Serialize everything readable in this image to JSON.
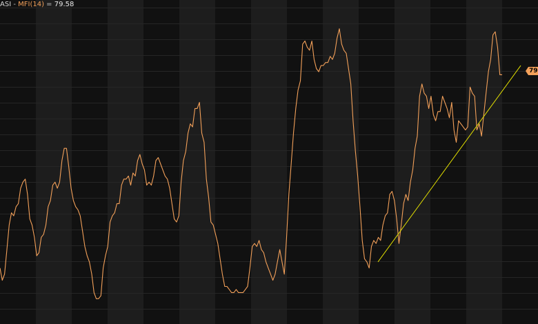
{
  "legend": {
    "ticker": "ASI",
    "separator": " - ",
    "indicator_name": "MFI(14)",
    "equals": " = ",
    "indicator_value": "79.58"
  },
  "value_tag": "79",
  "colors": {
    "background": "#000000",
    "band_dark": "#111111",
    "band_light": "#1d1d1d",
    "gridline": "#262626",
    "mfi_line": "#f4a15a",
    "trendline": "#e3e000",
    "tag": "#f4a15a"
  },
  "chart_data": {
    "type": "line",
    "title": "",
    "xlabel": "",
    "ylabel": "",
    "ylim": [
      0,
      100
    ],
    "grid": true,
    "series": [
      {
        "name": "MFI(14)",
        "values": [
          16,
          12,
          14,
          22,
          30,
          34,
          33,
          36,
          37,
          42,
          44,
          45,
          40,
          32,
          30,
          26,
          20,
          21,
          26,
          27,
          30,
          36,
          38,
          43,
          44,
          42,
          44,
          51,
          55,
          55,
          49,
          42,
          38,
          36,
          35,
          33,
          28,
          23,
          20,
          18,
          14,
          8,
          6,
          6,
          7,
          16,
          20,
          23,
          31,
          33,
          34,
          37,
          37,
          43,
          45,
          45,
          46,
          43,
          47,
          46,
          51,
          53,
          50,
          48,
          43,
          44,
          43,
          46,
          51,
          52,
          50,
          48,
          46,
          45,
          42,
          37,
          32,
          31,
          33,
          44,
          51,
          54,
          60,
          63,
          62,
          68,
          68,
          70,
          60,
          57,
          45,
          39,
          31,
          30,
          27,
          24,
          19,
          14,
          10,
          10,
          9,
          8,
          8,
          9,
          8,
          8,
          8,
          9,
          10,
          16,
          23,
          24,
          23,
          25,
          22,
          21,
          18,
          16,
          14,
          12,
          14,
          18,
          22,
          18,
          14,
          26,
          40,
          50,
          60,
          68,
          74,
          77,
          89,
          90,
          88,
          87,
          90,
          84,
          81,
          80,
          82,
          82,
          83,
          83,
          85,
          84,
          86,
          91,
          94,
          89,
          87,
          86,
          81,
          76,
          64,
          54,
          46,
          36,
          25,
          19,
          18,
          16,
          23,
          25,
          24,
          26,
          25,
          30,
          33,
          34,
          40,
          41,
          38,
          32,
          24,
          30,
          37,
          40,
          38,
          44,
          48,
          55,
          59,
          72,
          76,
          73,
          72,
          68,
          72,
          66,
          64,
          67,
          67,
          72,
          70,
          68,
          65,
          70,
          61,
          57,
          64,
          63,
          62,
          61,
          62,
          75,
          73,
          72,
          61,
          63,
          59,
          66,
          73,
          80,
          84,
          92,
          93,
          88,
          79,
          79
        ]
      },
      {
        "name": "trendline",
        "values": [
          18,
          82
        ]
      }
    ]
  }
}
